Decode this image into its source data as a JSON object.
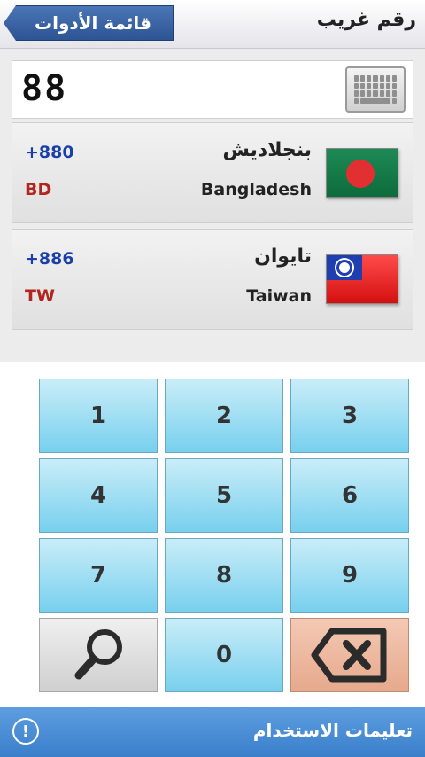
{
  "header": {
    "title": "رقم غريب",
    "back_label": "قائمة الأدوات"
  },
  "input": {
    "value": "88",
    "keyboard_icon": "keyboard-icon"
  },
  "results": [
    {
      "dial_code": "+880",
      "iso": "BD",
      "name_ar": "بنجلاديش",
      "name_en": "Bangladesh",
      "flag_icon": "bangladesh-flag-icon"
    },
    {
      "dial_code": "+886",
      "iso": "TW",
      "name_ar": "تايوان",
      "name_en": "Taiwan",
      "flag_icon": "taiwan-flag-icon"
    }
  ],
  "keypad": {
    "keys": [
      "1",
      "2",
      "3",
      "4",
      "5",
      "6",
      "7",
      "8",
      "9",
      "0"
    ],
    "search_icon": "search-icon",
    "backspace_icon": "backspace-icon"
  },
  "footer": {
    "label": "تعليمات الاستخدام",
    "info_icon": "info-icon",
    "info_glyph": "!"
  },
  "colors": {
    "header_back_button": "#2d5494",
    "key_blue": "#78d0ee",
    "key_backspace": "#e6a98c",
    "footer": "#3a7fcb",
    "dial_code": "#1a3fa8",
    "iso_code": "#b3261e"
  }
}
